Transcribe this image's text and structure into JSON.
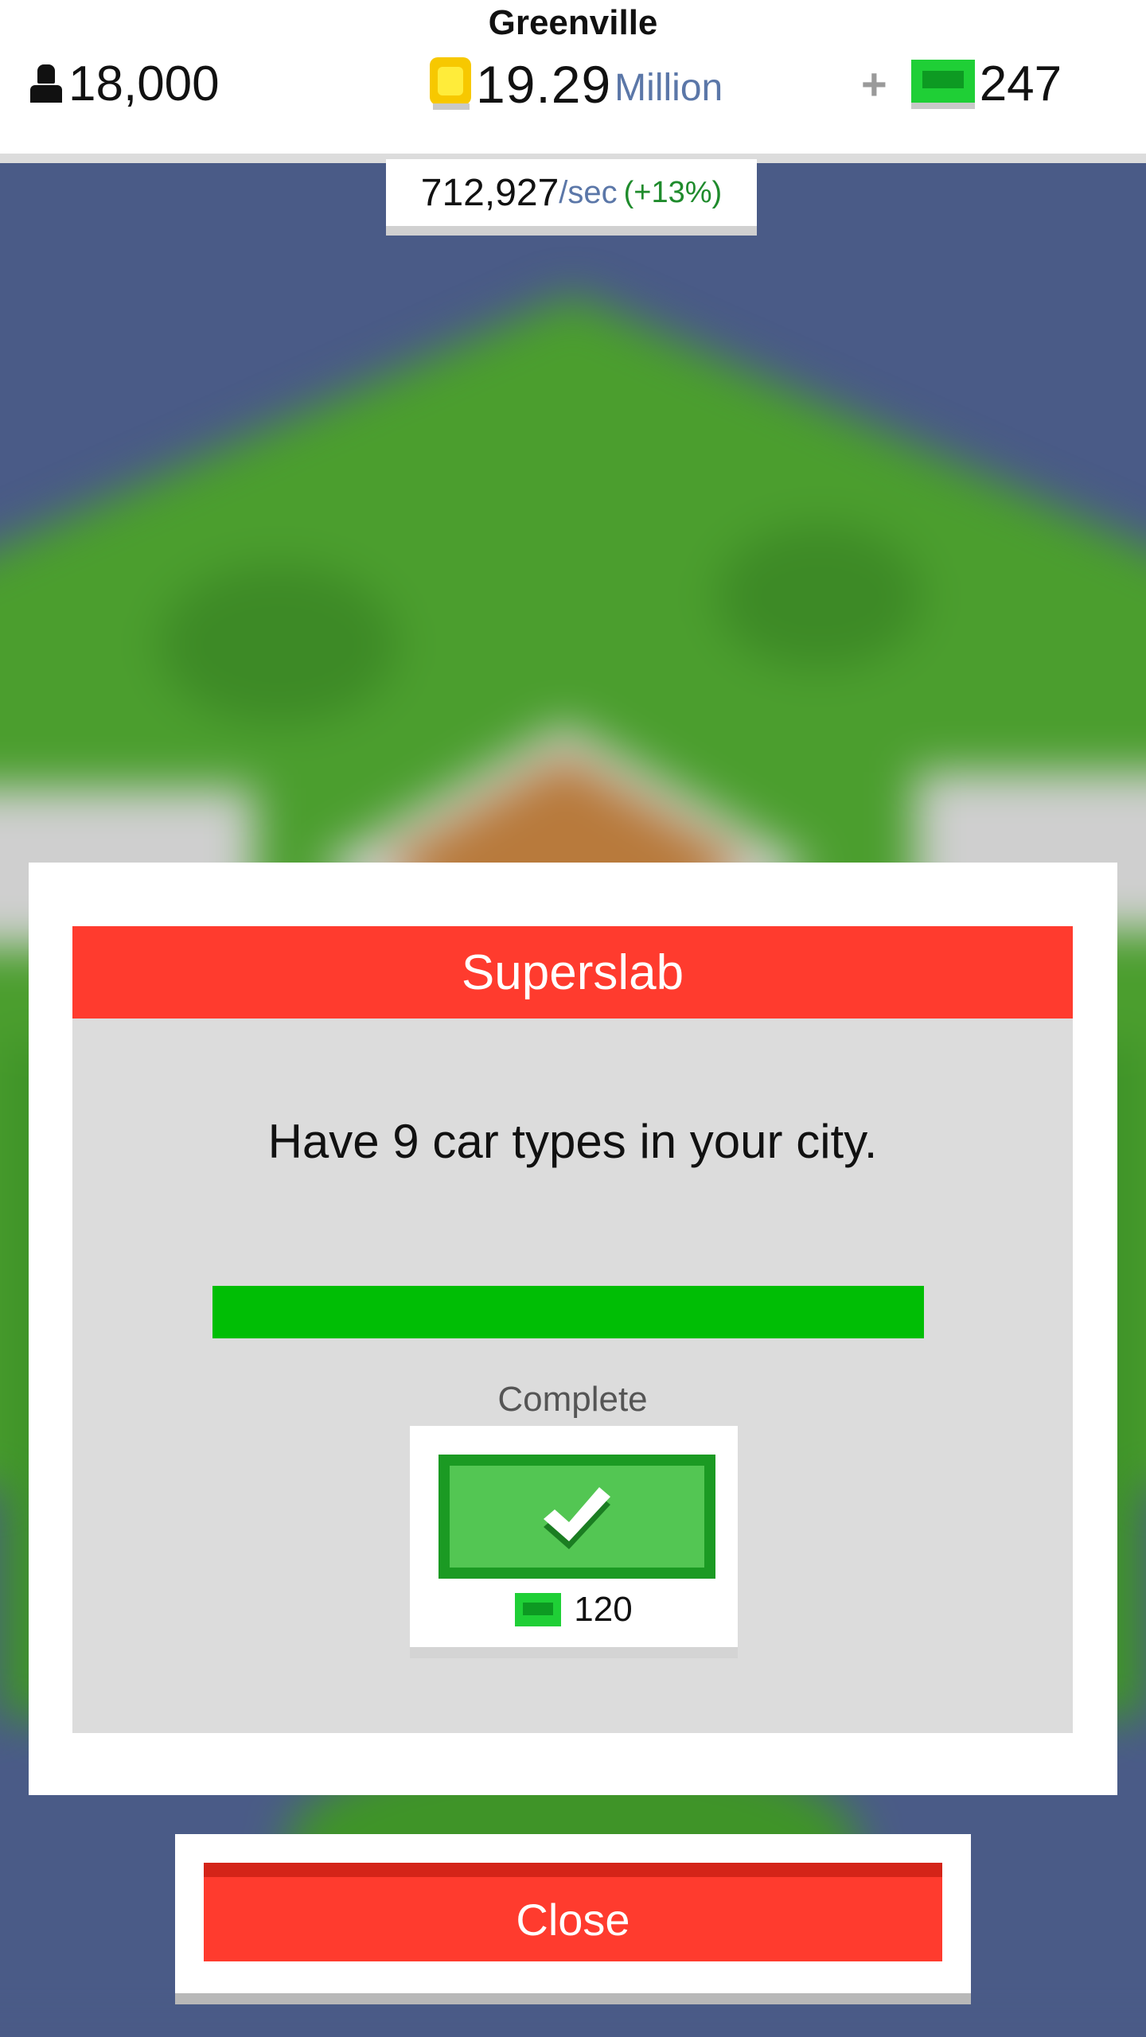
{
  "header": {
    "city_name": "Greenville",
    "population": "18,000",
    "money_amount": "19.29",
    "money_unit": "Million",
    "plus_label": "+",
    "gems": "247",
    "rate_value": "712,927",
    "rate_unit": "/sec",
    "rate_change": "(+13%)"
  },
  "modal": {
    "title": "Superslab",
    "description": "Have 9 car types in your city.",
    "progress": 1.0,
    "status": "Complete",
    "reward_amount": "120"
  },
  "close_label": "Close",
  "colors": {
    "header_red": "#ff3b2e",
    "progress_green": "#00be05",
    "claim_green": "#53c653",
    "claim_border": "#1b9a23",
    "rate_green": "#1f8b2c",
    "unit_blue": "#5b77a8"
  },
  "icons": {
    "population": "person-icon",
    "money": "coin-icon",
    "gems": "cash-icon",
    "claim": "check-icon"
  }
}
